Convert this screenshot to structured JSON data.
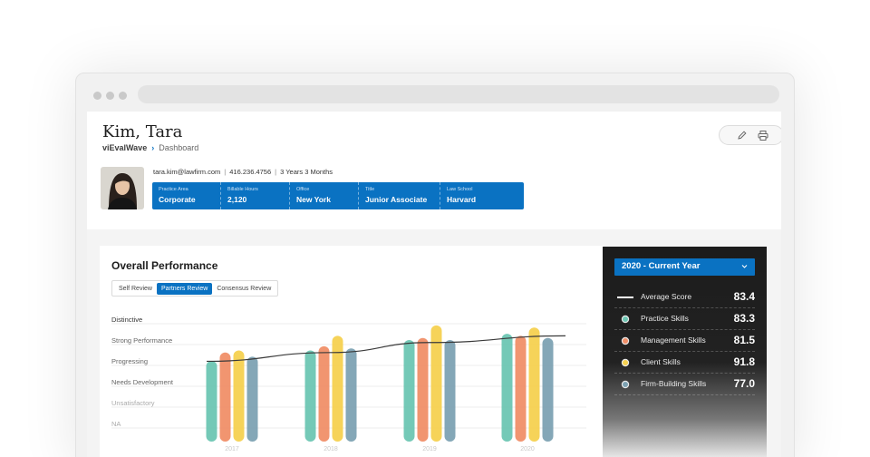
{
  "profile": {
    "name": "Kim, Tara",
    "breadcrumb": {
      "app": "viEvalWave",
      "page": "Dashboard"
    },
    "email": "tara.kim@lawfirm.com",
    "phone": "416.236.4756",
    "tenure": "3 Years 3 Months",
    "details": [
      {
        "label": "Practice Area",
        "value": "Corporate"
      },
      {
        "label": "Billable Hours",
        "value": "2,120"
      },
      {
        "label": "Office",
        "value": "New York"
      },
      {
        "label": "Title",
        "value": "Junior Associate"
      },
      {
        "label": "Law School",
        "value": "Harvard"
      }
    ]
  },
  "toolbar": {
    "icons": [
      "pencil-icon",
      "printer-icon"
    ]
  },
  "performance": {
    "title": "Overall Performance",
    "tabs": [
      {
        "label": "Self Review",
        "active": false
      },
      {
        "label": "Partners Review",
        "active": true
      },
      {
        "label": "Consensus Review",
        "active": false
      }
    ]
  },
  "chart_data": {
    "type": "bar",
    "categories": [
      "2017",
      "2018",
      "2019",
      "2020"
    ],
    "y_levels": [
      "Distinctive",
      "Strong Performance",
      "Progressing",
      "Needs Development",
      "Unsatisfactory",
      "NA"
    ],
    "ylim": [
      0,
      5
    ],
    "series": [
      {
        "name": "Practice Skills",
        "color": "#6dc6b3",
        "values": [
          3.0,
          3.5,
          4.0,
          4.3
        ]
      },
      {
        "name": "Management Skills",
        "color": "#f08f68",
        "values": [
          3.4,
          3.7,
          4.1,
          4.2
        ]
      },
      {
        "name": "Client Skills",
        "color": "#f6d150",
        "values": [
          3.5,
          4.2,
          4.7,
          4.6
        ]
      },
      {
        "name": "Firm-Building Skills",
        "color": "#7da2b3",
        "values": [
          3.2,
          3.6,
          4.0,
          4.1
        ]
      }
    ],
    "trend": {
      "name": "Average Score",
      "values": [
        2.98,
        3.4,
        3.88,
        4.2
      ]
    },
    "grid": true
  },
  "panel": {
    "year": "2020 - Current Year",
    "metrics": [
      {
        "label": "Average Score",
        "score": "83.4",
        "marker": "line",
        "color": "#ffffff"
      },
      {
        "label": "Practice Skills",
        "score": "83.3",
        "marker": "dot",
        "color": "#6dc6b3"
      },
      {
        "label": "Management Skills",
        "score": "81.5",
        "marker": "dot",
        "color": "#f08f68"
      },
      {
        "label": "Client Skills",
        "score": "91.8",
        "marker": "dot",
        "color": "#f6d150"
      },
      {
        "label": "Firm-Building Skills",
        "score": "77.0",
        "marker": "dot",
        "color": "#7da2b3"
      }
    ]
  }
}
